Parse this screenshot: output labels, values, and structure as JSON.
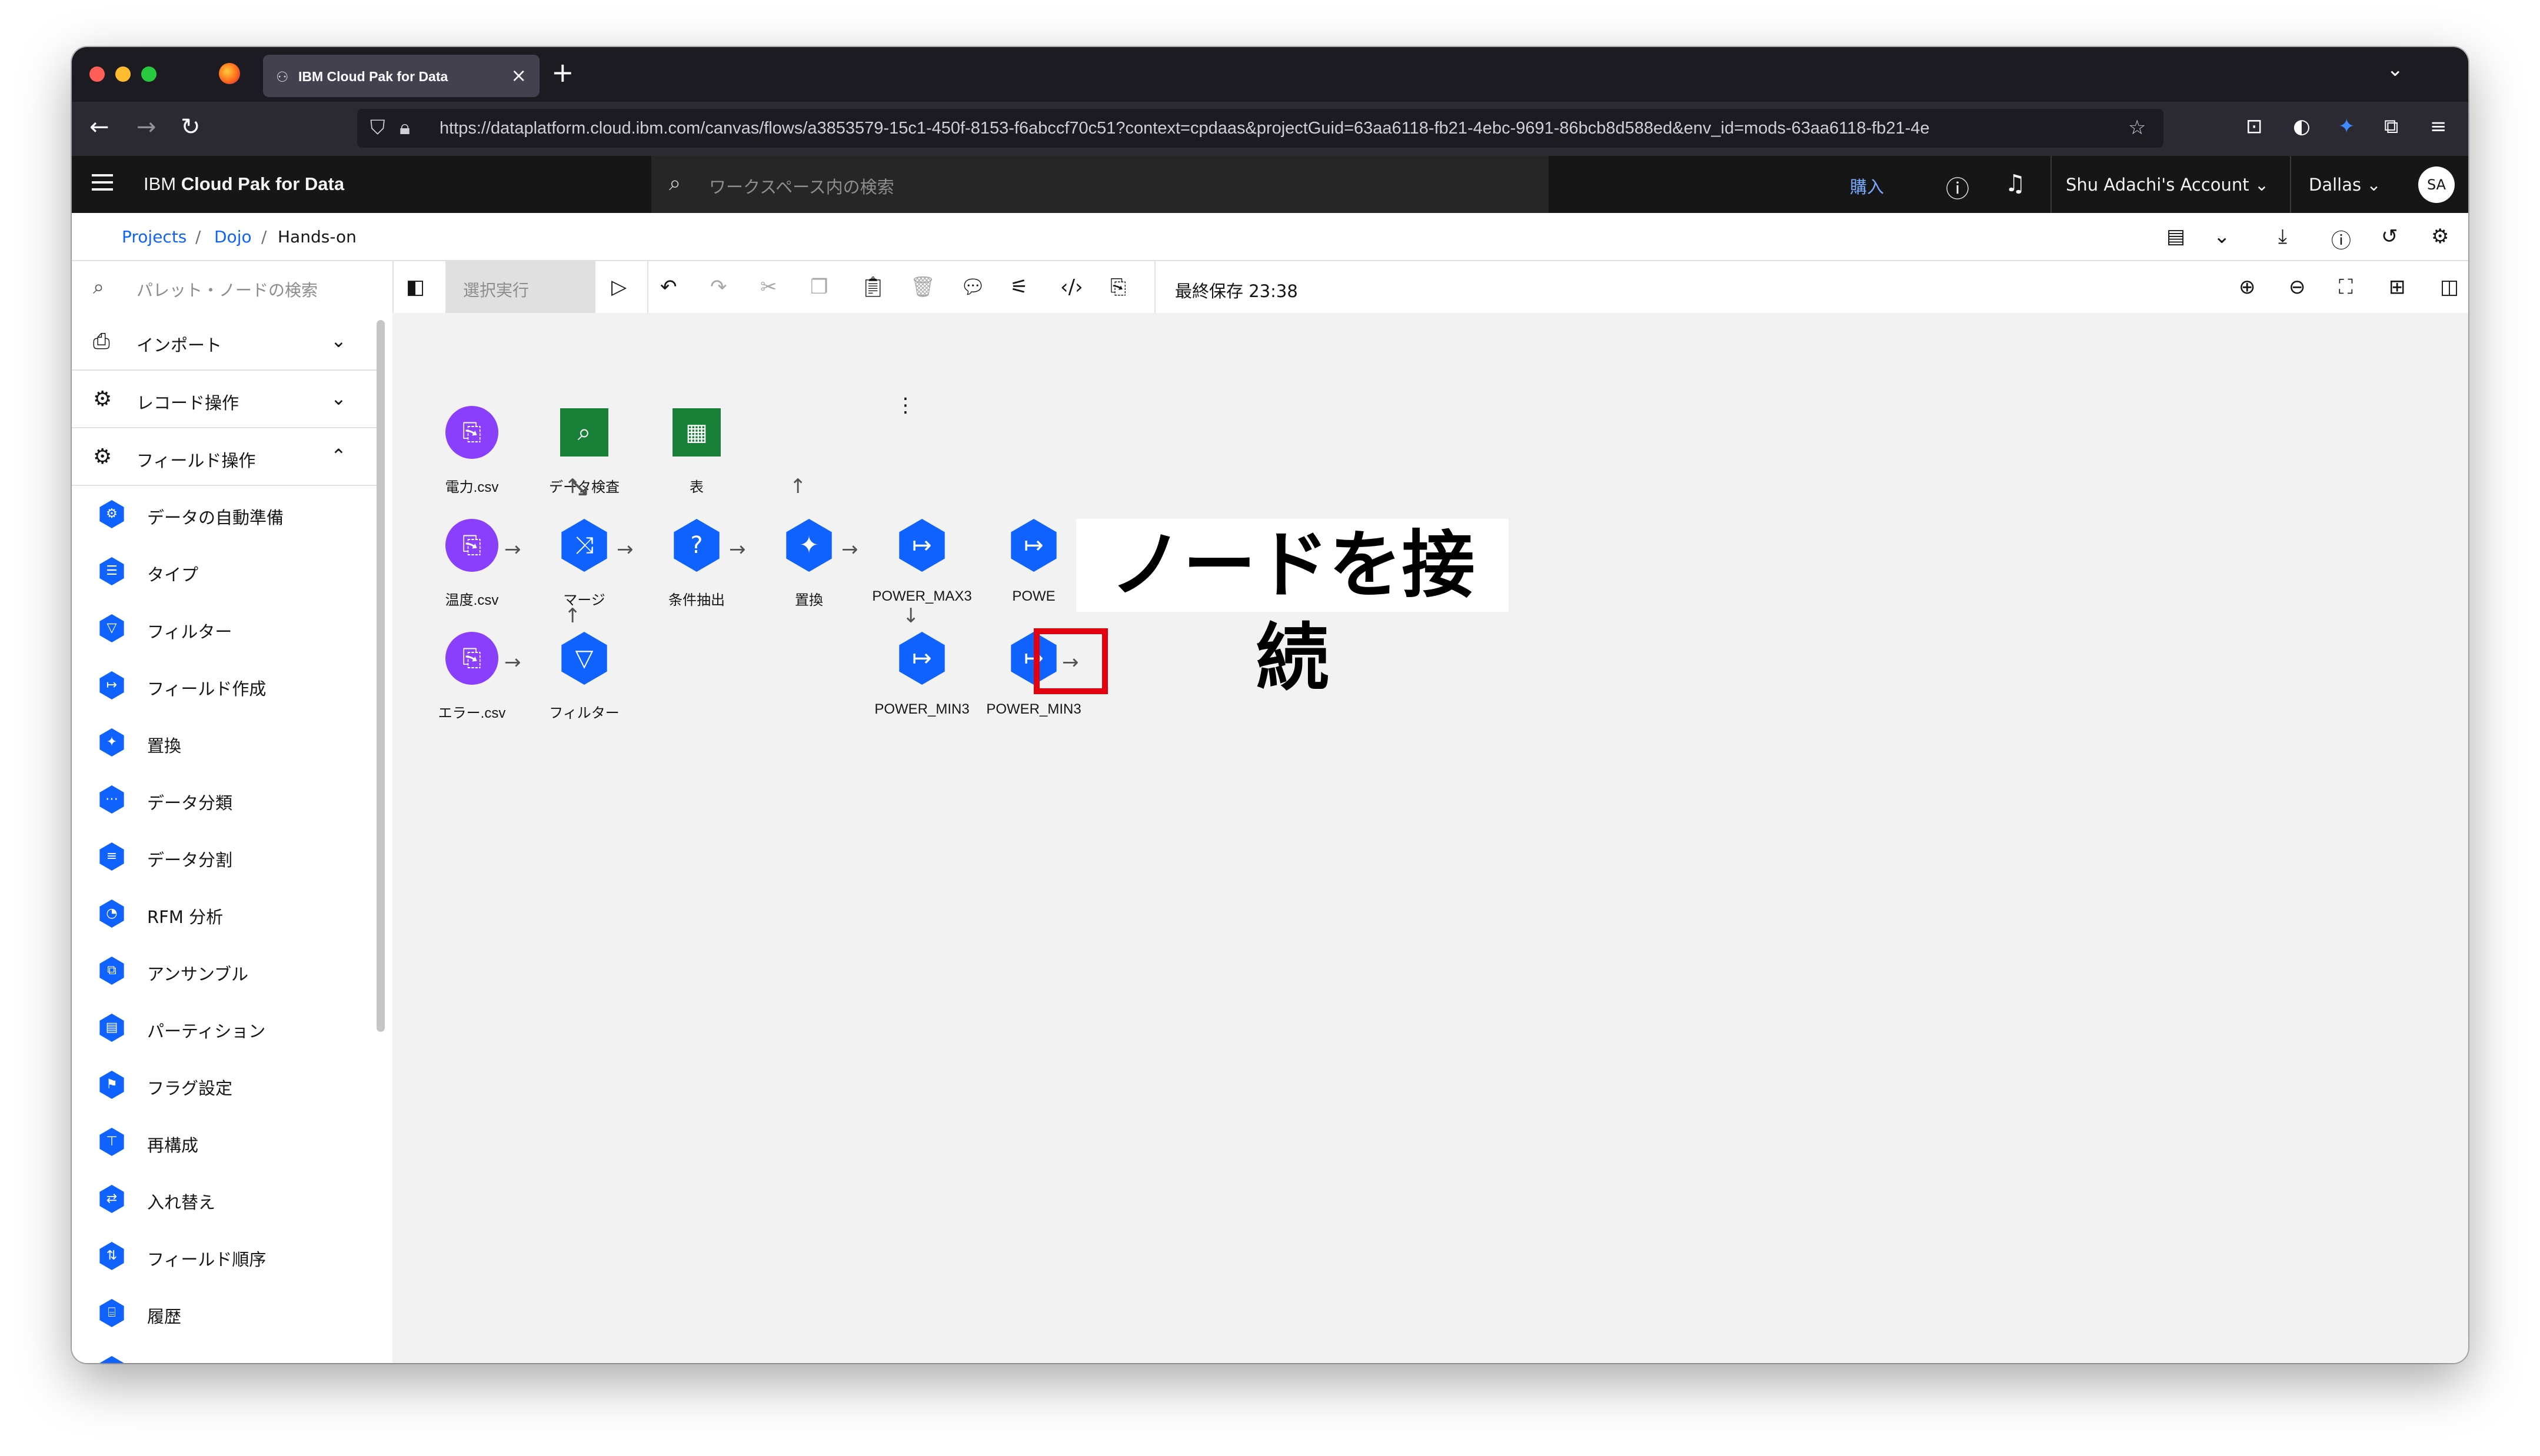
{
  "browser": {
    "tab_title": "IBM Cloud Pak for Data",
    "url": "https://dataplatform.cloud.ibm.com/canvas/flows/a3853579-15c1-450f-8153-f6abccf70c51?context=cpdaas&projectGuid=63aa6118-fb21-4ebc-9691-86bcb8d588ed&env_id=mods-63aa6118-fb21-4e",
    "traffic_lights": [
      "#ff5f57",
      "#febc2e",
      "#28c840"
    ]
  },
  "header": {
    "brand_prefix": "IBM",
    "brand_name": "Cloud Pak for Data",
    "search_placeholder": "ワークスペース内の検索",
    "buy_label": "購入",
    "account": "Shu Adachi's Account",
    "region": "Dallas",
    "avatar": "SA"
  },
  "breadcrumb": {
    "items": [
      "Projects",
      "Dojo",
      "Hands-on"
    ],
    "separator": "/"
  },
  "toolbar": {
    "palette_search_placeholder": "パレット・ノードの検索",
    "run_selection": "選択実行",
    "last_saved": "最終保存 23:38"
  },
  "palette": {
    "sections": [
      {
        "label": "インポート",
        "expanded": false
      },
      {
        "label": "レコード操作",
        "expanded": false
      },
      {
        "label": "フィールド操作",
        "expanded": true
      }
    ],
    "items": [
      "データの自動準備",
      "タイプ",
      "フィルター",
      "フィールド作成",
      "置換",
      "データ分類",
      "データ分割",
      "RFM 分析",
      "アンサンブル",
      "パーティション",
      "フラグ設定",
      "再構成",
      "入れ替え",
      "フィールド順序",
      "履歴"
    ]
  },
  "canvas": {
    "nodes": [
      {
        "label": "電力.csv",
        "kind": "source"
      },
      {
        "label": "データ検査",
        "kind": "output"
      },
      {
        "label": "表",
        "kind": "output"
      },
      {
        "label": "温度.csv",
        "kind": "source"
      },
      {
        "label": "マージ",
        "kind": "process"
      },
      {
        "label": "条件抽出",
        "kind": "process"
      },
      {
        "label": "置換",
        "kind": "process"
      },
      {
        "label": "POWER_MAX3",
        "kind": "process"
      },
      {
        "label": "POWE",
        "kind": "process"
      },
      {
        "label": "エラー.csv",
        "kind": "source"
      },
      {
        "label": "フィルター",
        "kind": "process"
      },
      {
        "label": "POWER_MIN3",
        "kind": "process"
      },
      {
        "label": "POWER_MIN3",
        "kind": "process"
      }
    ],
    "callout": "ノードを接続",
    "colors": {
      "source": "#8a3ffc",
      "process": "#0f62fe",
      "output": "#198038",
      "highlight": "#e3000f"
    }
  }
}
